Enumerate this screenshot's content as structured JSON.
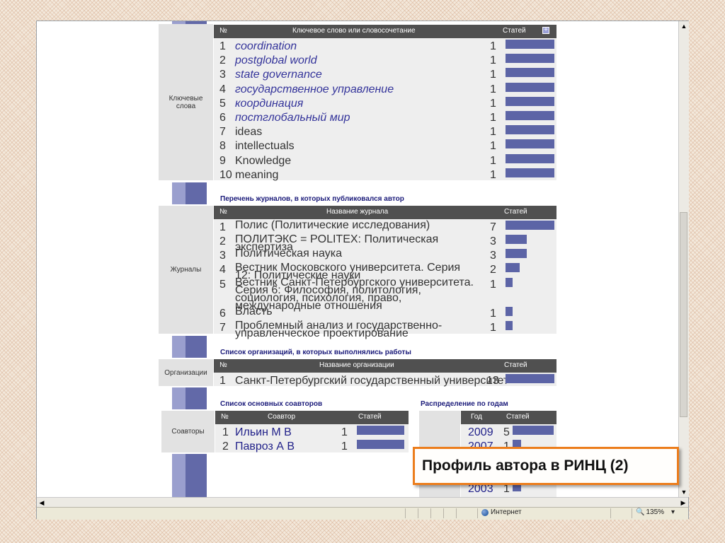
{
  "keywords": {
    "side_label": "Ключевые слова",
    "col_no": "№",
    "col_name": "Ключевое слово или словосочетание",
    "col_count": "Статей",
    "rows": [
      {
        "n": "1",
        "name": "coordination",
        "count": "1",
        "value": 1
      },
      {
        "n": "2",
        "name": "postglobal world",
        "count": "1",
        "value": 1
      },
      {
        "n": "3",
        "name": "state governance",
        "count": "1",
        "value": 1
      },
      {
        "n": "4",
        "name": "государственное управление",
        "count": "1",
        "value": 1
      },
      {
        "n": "5",
        "name": "координация",
        "count": "1",
        "value": 1
      },
      {
        "n": "6",
        "name": "постглобальный мир",
        "count": "1",
        "value": 1
      },
      {
        "n": "7",
        "name": "ideas",
        "count": "1",
        "value": 1
      },
      {
        "n": "8",
        "name": "intellectuals",
        "count": "1",
        "value": 1
      },
      {
        "n": "9",
        "name": "Knowledge",
        "count": "1",
        "value": 1
      },
      {
        "n": "10",
        "name": "meaning",
        "count": "1",
        "value": 1
      }
    ]
  },
  "journals": {
    "section_title": "Перечень журналов, в которых публиковался автор",
    "side_label": "Журналы",
    "col_no": "№",
    "col_name": "Название журнала",
    "col_count": "Статей",
    "rows": [
      {
        "n": "1",
        "name": "Полис (Политические исследования)",
        "count": "7",
        "value": 7
      },
      {
        "n": "2",
        "name": "ПОЛИТЭКС = POLITEX: Политическая экспертиза",
        "count": "3",
        "value": 3
      },
      {
        "n": "3",
        "name": "Политическая наука",
        "count": "3",
        "value": 3
      },
      {
        "n": "4",
        "name": "Вестник Московского университета. Серия 12: Политические науки",
        "count": "2",
        "value": 2
      },
      {
        "n": "5",
        "name": "Вестник Санкт-Петербургского университета. Серия 6: Философия, политология, социология, психология, право, международные отношения",
        "count": "1",
        "value": 1
      },
      {
        "n": "6",
        "name": "Власть",
        "count": "1",
        "value": 1
      },
      {
        "n": "7",
        "name": "Проблемный анализ и государственно-управленческое проектирование",
        "count": "1",
        "value": 1
      }
    ]
  },
  "orgs": {
    "section_title": "Список организаций, в которых выполнялись работы",
    "side_label": "Организации",
    "col_no": "№",
    "col_name": "Название организации",
    "col_count": "Статей",
    "rows": [
      {
        "n": "1",
        "name": "Санкт-Петербургский государственный университет",
        "count": "13",
        "value": 13
      }
    ]
  },
  "coauthors": {
    "section_title": "Список основных соавторов",
    "side_label": "Соавторы",
    "col_no": "№",
    "col_name": "Соавтор",
    "col_count": "Статей",
    "rows": [
      {
        "n": "1",
        "name": "Ильин М В",
        "count": "1",
        "value": 1
      },
      {
        "n": "2",
        "name": "Павроз А В",
        "count": "1",
        "value": 1
      }
    ]
  },
  "years": {
    "section_title": "Распределение по годам",
    "col_year": "Год",
    "col_count": "Статей",
    "rows": [
      {
        "year": "2009",
        "count": "5",
        "value": 5
      },
      {
        "year": "2007",
        "count": "1",
        "value": 1
      },
      {
        "year": "2003",
        "count": "1",
        "value": 1
      }
    ]
  },
  "statusbar": {
    "zone": "Интернет",
    "zoom": "135%"
  },
  "slide_title": "Профиль автора в РИНЦ (2)",
  "colors": {
    "bar": "#5c64a6",
    "header": "#505050",
    "accent_border": "#ec7d1c"
  }
}
